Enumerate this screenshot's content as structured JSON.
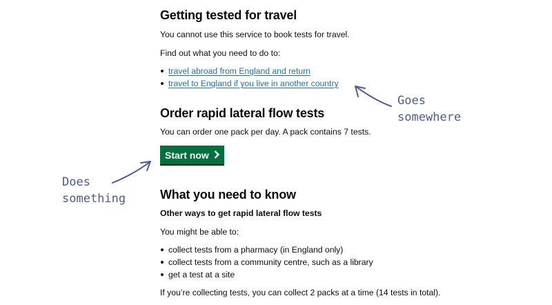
{
  "travel": {
    "heading": "Getting tested for travel",
    "intro": "You cannot use this service to book tests for travel.",
    "find_out": "Find out what you need to do to:",
    "links": [
      "travel abroad from England and return",
      "travel to England if you live in another country"
    ]
  },
  "order": {
    "heading": "Order rapid lateral flow tests",
    "text": "You can order one pack per day. A pack contains 7 tests.",
    "start_label": "Start now",
    "start_icon": "chevron-right-icon"
  },
  "know": {
    "heading": "What you need to know",
    "subheading": "Other ways to get rapid lateral flow tests",
    "might": "You might be able to:",
    "options": [
      "collect tests from a pharmacy (in England only)",
      "collect tests from a community centre, such as a library",
      "get a test at a site"
    ],
    "collecting": "If you’re collecting tests, you can collect 2 packs at a time (14 tests in total)."
  },
  "annotations": {
    "goes_line1": "Goes",
    "goes_line2": "somewhere",
    "does_line1": "Does",
    "does_line2": "something",
    "color": "#4a5a9a"
  },
  "colors": {
    "link": "#1d70b8",
    "button": "#00703c",
    "text": "#0b0c0c"
  }
}
